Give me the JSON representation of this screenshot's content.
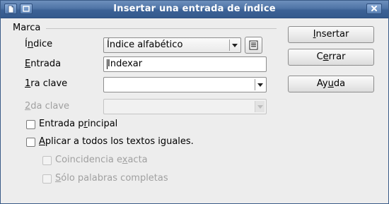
{
  "window": {
    "title": "Insertar una entrada de índice"
  },
  "group": {
    "label": "Marca"
  },
  "form": {
    "index_label_pre": "Í",
    "index_label_mnemonic": "n",
    "index_label_post": "dice",
    "index_value": "Índice alfabético",
    "entry_label_pre": "",
    "entry_label_mnemonic": "E",
    "entry_label_post": "ntrada",
    "entry_value": "Indexar",
    "key1_label_pre": "",
    "key1_label_mnemonic": "1",
    "key1_label_post": "ra clave",
    "key1_value": "",
    "key2_label_pre": "",
    "key2_label_mnemonic": "2",
    "key2_label_post": "da clave",
    "key2_value": ""
  },
  "options": {
    "main_entry_pre": "Entrada p",
    "main_entry_mnemonic": "r",
    "main_entry_post": "incipal",
    "main_entry_checked": false,
    "apply_all_pre": "",
    "apply_all_mnemonic": "A",
    "apply_all_post": "plicar a todos los textos iguales.",
    "apply_all_checked": false,
    "exact_match_pre": "Coincidencia e",
    "exact_match_mnemonic": "x",
    "exact_match_post": "acta",
    "exact_match_checked": false,
    "whole_words_pre": "",
    "whole_words_mnemonic": "S",
    "whole_words_post": "ólo palabras completas",
    "whole_words_checked": false
  },
  "buttons": {
    "insert_pre": "",
    "insert_mnemonic": "I",
    "insert_post": "nsertar",
    "close_pre": "C",
    "close_mnemonic": "e",
    "close_post": "rrar",
    "help_pre": "Ay",
    "help_mnemonic": "u",
    "help_post": "da"
  },
  "icons": {
    "app": "document-icon",
    "restore": "restore-window-icon",
    "close": "close-window-icon",
    "index_dialog": "index-list-icon"
  },
  "colors": {
    "titlebar": "#4f74a6",
    "dialog_bg": "#ededed",
    "disabled_text": "#a0a0a0"
  }
}
